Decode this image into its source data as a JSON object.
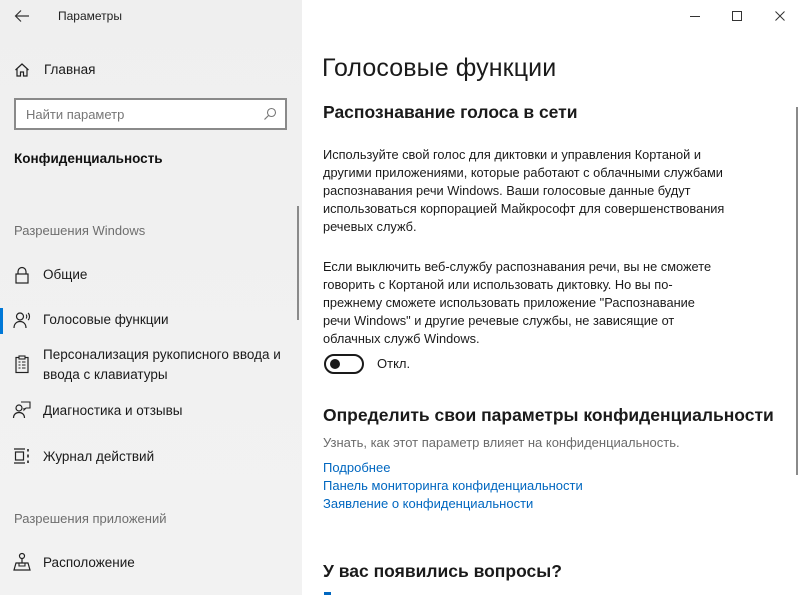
{
  "window": {
    "app_title": "Параметры",
    "controls": {
      "minimize": "minimize-icon",
      "maximize": "maximize-icon",
      "close": "close-icon"
    }
  },
  "sidebar": {
    "back_icon": "arrow-left-icon",
    "home": {
      "label": "Главная",
      "icon": "home-icon"
    },
    "search": {
      "placeholder": "Найти параметр",
      "value": "",
      "icon": "search-icon"
    },
    "current_section": "Конфиденциальность",
    "groups": [
      {
        "header": "Разрешения Windows",
        "items": [
          {
            "label": "Общие",
            "icon": "lock-icon",
            "active": false
          },
          {
            "label": "Голосовые функции",
            "icon": "speech-person-icon",
            "active": true
          },
          {
            "label": "Персонализация рукописного ввода и ввода с клавиатуры",
            "line1": "Персонализация рукописного ввода и",
            "line2": "ввода с клавиатуры",
            "icon": "clipboard-icon",
            "active": false
          },
          {
            "label": "Диагностика и отзывы",
            "icon": "feedback-person-icon",
            "active": false
          },
          {
            "label": "Журнал действий",
            "icon": "timeline-icon",
            "active": false
          }
        ]
      },
      {
        "header": "Разрешения приложений",
        "items": [
          {
            "label": "Расположение",
            "icon": "location-icon",
            "active": false
          }
        ]
      }
    ]
  },
  "main": {
    "page_title": "Голосовые функции",
    "online_speech": {
      "heading": "Распознавание голоса в сети",
      "para1_lines": [
        "Используйте свой голос для диктовки и управления Кортаной и",
        "другими приложениями, которые работают с облачными службами",
        "распознавания речи Windows. Ваши голосовые данные будут",
        "использоваться корпорацией Майкрософт для совершенствования",
        "речевых служб."
      ],
      "para2_lines": [
        "Если выключить веб-службу распознавания речи, вы не сможете",
        "говорить с Кортаной или использовать диктовку. Но вы по-",
        "прежнему сможете использовать приложение \"Распознавание",
        "речи Windows\" и другие речевые службы, не зависящие от",
        "облачных служб Windows."
      ],
      "toggle": {
        "state": "off",
        "label": "Откл."
      }
    },
    "privacy": {
      "heading": "Определить свои параметры конфиденциальности",
      "description": "Узнать, как этот параметр влияет на конфиденциальность.",
      "links": [
        "Подробнее",
        "Панель мониторинга конфиденциальности",
        "Заявление о конфиденциальности"
      ]
    },
    "questions": {
      "heading": "У вас появились вопросы?"
    }
  },
  "colors": {
    "accent": "#0078d7",
    "link": "#0067c0",
    "sidebar_bg": "#f0f0f0",
    "muted_text": "#6b6b6b"
  }
}
